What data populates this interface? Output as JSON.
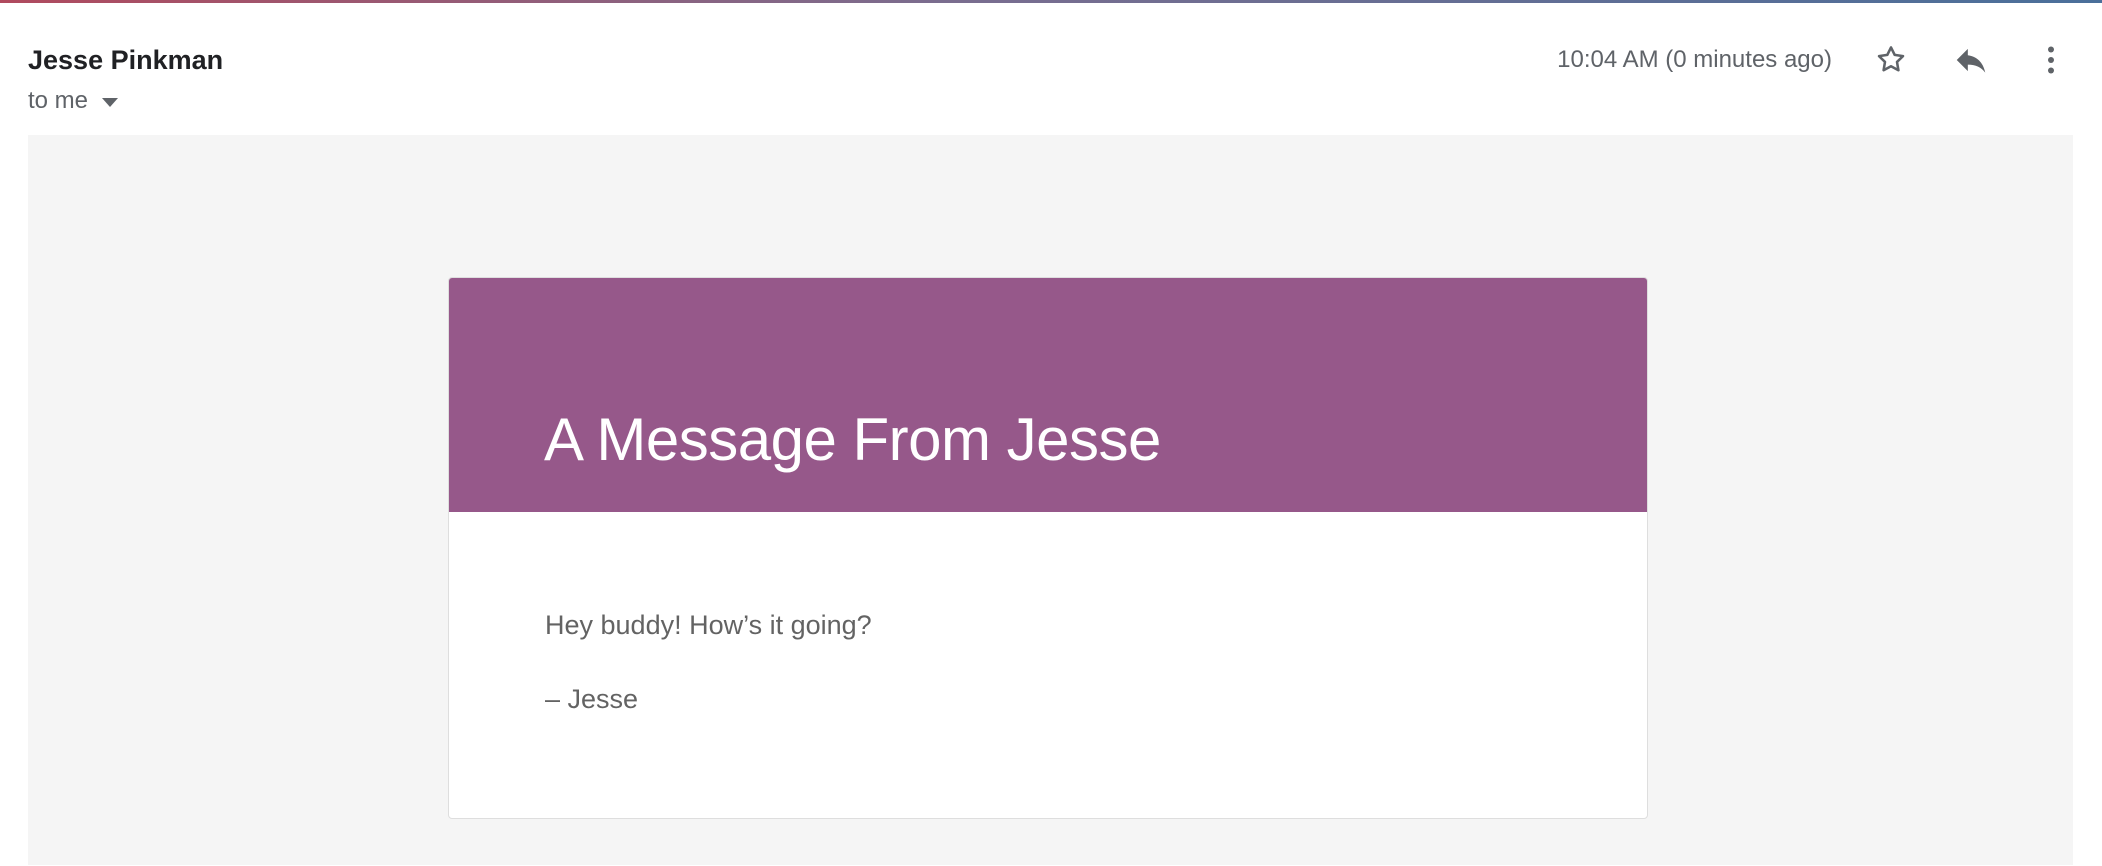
{
  "email": {
    "sender_name": "Jesse Pinkman",
    "recipient_label": "to me",
    "timestamp": "10:04 AM (0 minutes ago)"
  },
  "actions": {
    "star_icon": "star-outline-icon",
    "reply_icon": "reply-icon",
    "more_icon": "more-vertical-icon"
  },
  "message": {
    "banner_title": "A Message From Jesse",
    "greeting": "Hey buddy! How’s it going?",
    "signature": "– Jesse"
  },
  "colors": {
    "banner": "#96588a",
    "canvas": "#f5f5f5",
    "body_text": "#636363"
  }
}
